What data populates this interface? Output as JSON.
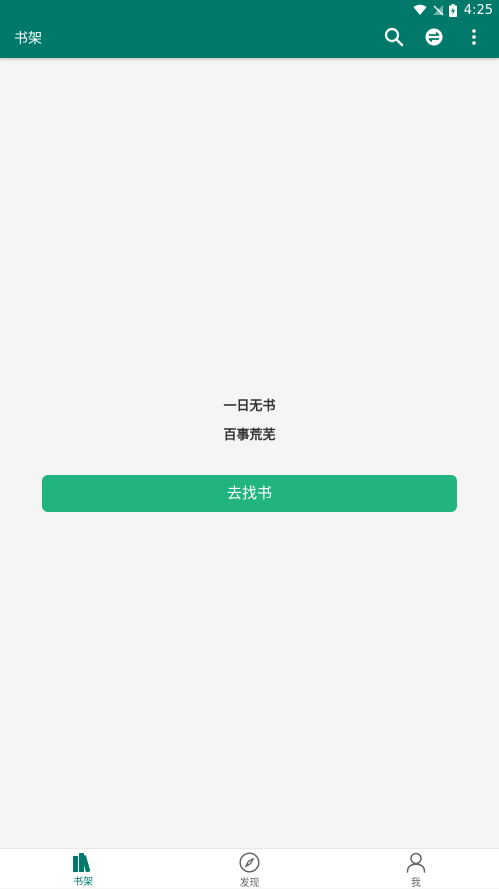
{
  "status_bar": {
    "time": "4:25",
    "icons": [
      "wifi-icon",
      "no-signal-icon",
      "battery-charging-icon"
    ]
  },
  "app_bar": {
    "title": "书架",
    "actions": [
      "search-icon",
      "filter-icon",
      "more-vert-icon"
    ]
  },
  "empty_state": {
    "line1": "一日无书",
    "line2": "百事荒芜",
    "button_label": "去找书"
  },
  "bottom_nav": {
    "items": [
      {
        "label": "书架",
        "icon": "bookshelf-icon",
        "active": true
      },
      {
        "label": "发现",
        "icon": "compass-icon",
        "active": false
      },
      {
        "label": "我",
        "icon": "person-icon",
        "active": false
      }
    ]
  },
  "colors": {
    "primary": "#00796b",
    "accent_button": "#22b47f",
    "background": "#f5f5f5"
  }
}
